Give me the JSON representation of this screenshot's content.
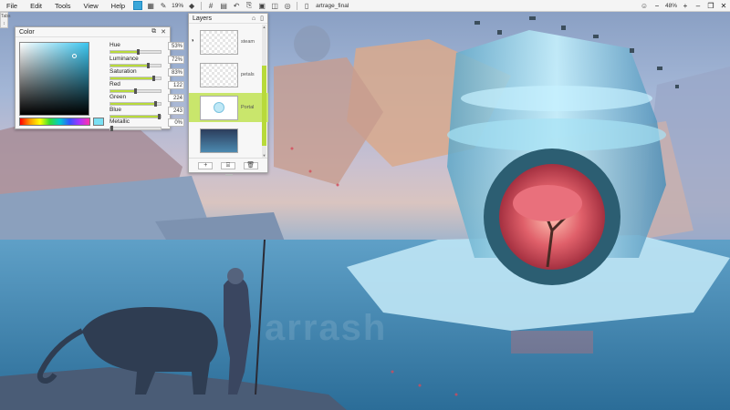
{
  "menubar": {
    "menus": [
      "File",
      "Edit",
      "Tools",
      "View",
      "Help"
    ],
    "zoom_small": "19%",
    "document_title": "artrage_final",
    "zoom_right": "48%",
    "zoom_minus": "−",
    "zoom_plus": "+",
    "win_minimize": "–",
    "win_restore": "❐",
    "win_close": "✕"
  },
  "left_strip": {
    "label": "Tabs"
  },
  "color_panel": {
    "title": "Color",
    "sliders": [
      {
        "label": "Hue",
        "value": "53%",
        "level": 0.53
      },
      {
        "label": "Luminance",
        "value": "72%",
        "level": 0.72
      },
      {
        "label": "Saturation",
        "value": "83%",
        "level": 0.83
      },
      {
        "label": "Red",
        "value": "122",
        "level": 0.48
      },
      {
        "label": "Green",
        "value": "224",
        "level": 0.88
      },
      {
        "label": "Blue",
        "value": "243",
        "level": 0.95
      },
      {
        "label": "Metallic",
        "value": "0%",
        "level": 0.0
      }
    ],
    "swatch_color": "#7ae0f3"
  },
  "layers_panel": {
    "title": "Layers",
    "layers": [
      {
        "name": "steam",
        "selected": false
      },
      {
        "name": "petals",
        "selected": false
      },
      {
        "name": "Portal",
        "selected": true
      },
      {
        "name": "",
        "selected": false
      }
    ],
    "footer_add": "+",
    "footer_folder": "⌸",
    "footer_delete": "🗑"
  },
  "canvas": {
    "watermark": "arrash"
  },
  "colors": {
    "accent_green": "#b8da3a",
    "active_blue": "#3ba7d9"
  }
}
